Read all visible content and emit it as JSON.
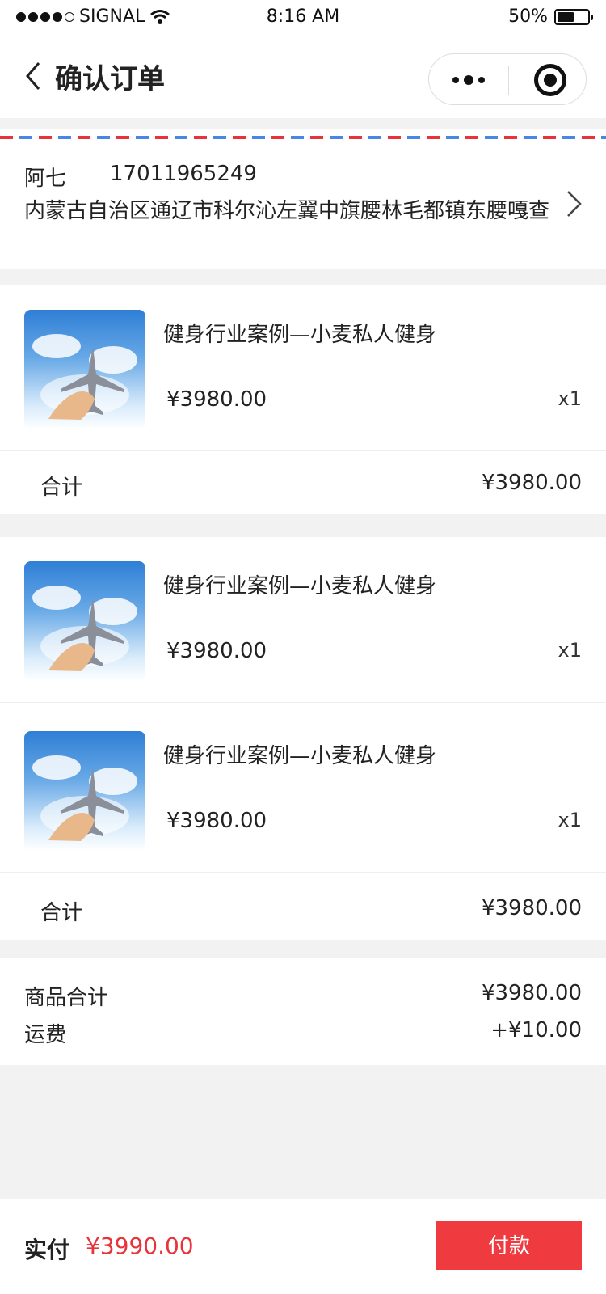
{
  "status_bar": {
    "signal": "SIGNAL",
    "time": "8:16 AM",
    "battery": "50%",
    "battery_level": 0.5
  },
  "nav": {
    "title": "确认订单"
  },
  "address": {
    "name": "阿七",
    "phone": "17011965249",
    "detail": "内蒙古自治区通辽市科尔沁左翼中旗腰林毛都镇东腰嘎查"
  },
  "groups": [
    {
      "items": [
        {
          "title": "健身行业案例—小麦私人健身",
          "price": "¥3980.00",
          "qty": "x1"
        }
      ],
      "subtotal_label": "合计",
      "subtotal_value": "¥3980.00"
    },
    {
      "items": [
        {
          "title": "健身行业案例—小麦私人健身",
          "price": "¥3980.00",
          "qty": "x1"
        },
        {
          "title": "健身行业案例—小麦私人健身",
          "price": "¥3980.00",
          "qty": "x1"
        }
      ],
      "subtotal_label": "合计",
      "subtotal_value": "¥3980.00"
    }
  ],
  "summary": {
    "goods_label": "商品合计",
    "goods_value": "¥3980.00",
    "shipping_label": "运费",
    "shipping_value": "+¥10.00"
  },
  "footer": {
    "paid_label": "实付",
    "paid_amount": "¥3990.00",
    "pay_button": "付款"
  },
  "colors": {
    "accent": "#ef3b40",
    "price_red": "#e8333b",
    "stripe_blue": "#4a86e8"
  },
  "icons": [
    "wifi-icon",
    "battery-icon",
    "back-icon",
    "more-icon",
    "close-capsule-icon",
    "chevron-right-icon"
  ]
}
